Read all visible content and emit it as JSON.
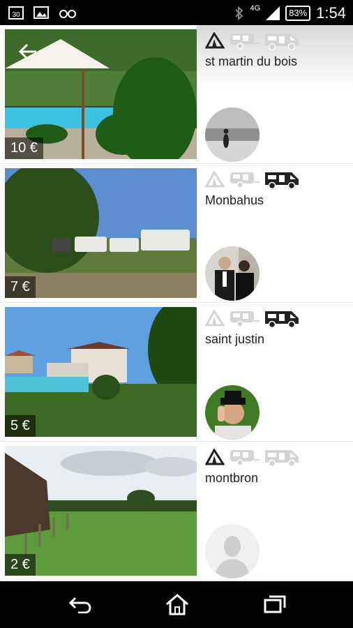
{
  "status_bar": {
    "left_icons": [
      "calendar-30-icon",
      "image-icon",
      "glasses-icon"
    ],
    "network": "4G",
    "battery": "83%",
    "time": "1:54"
  },
  "listings": [
    {
      "price": "10 €",
      "place": "st martin du bois",
      "tent": true,
      "caravan": false,
      "motorhome": false,
      "scene": "pool-garden"
    },
    {
      "price": "7 €",
      "place": "Monbahus",
      "tent": false,
      "caravan": false,
      "motorhome": true,
      "scene": "camper-field"
    },
    {
      "price": "5 €",
      "place": "saint justin",
      "tent": false,
      "caravan": false,
      "motorhome": true,
      "scene": "house-pool"
    },
    {
      "price": "2 €",
      "place": "montbron",
      "tent": true,
      "caravan": false,
      "motorhome": false,
      "scene": "meadow"
    }
  ],
  "colors": {
    "active_icon": "#222222",
    "inactive_icon": "#d4d4d4",
    "divider": "#e6e6e6"
  }
}
